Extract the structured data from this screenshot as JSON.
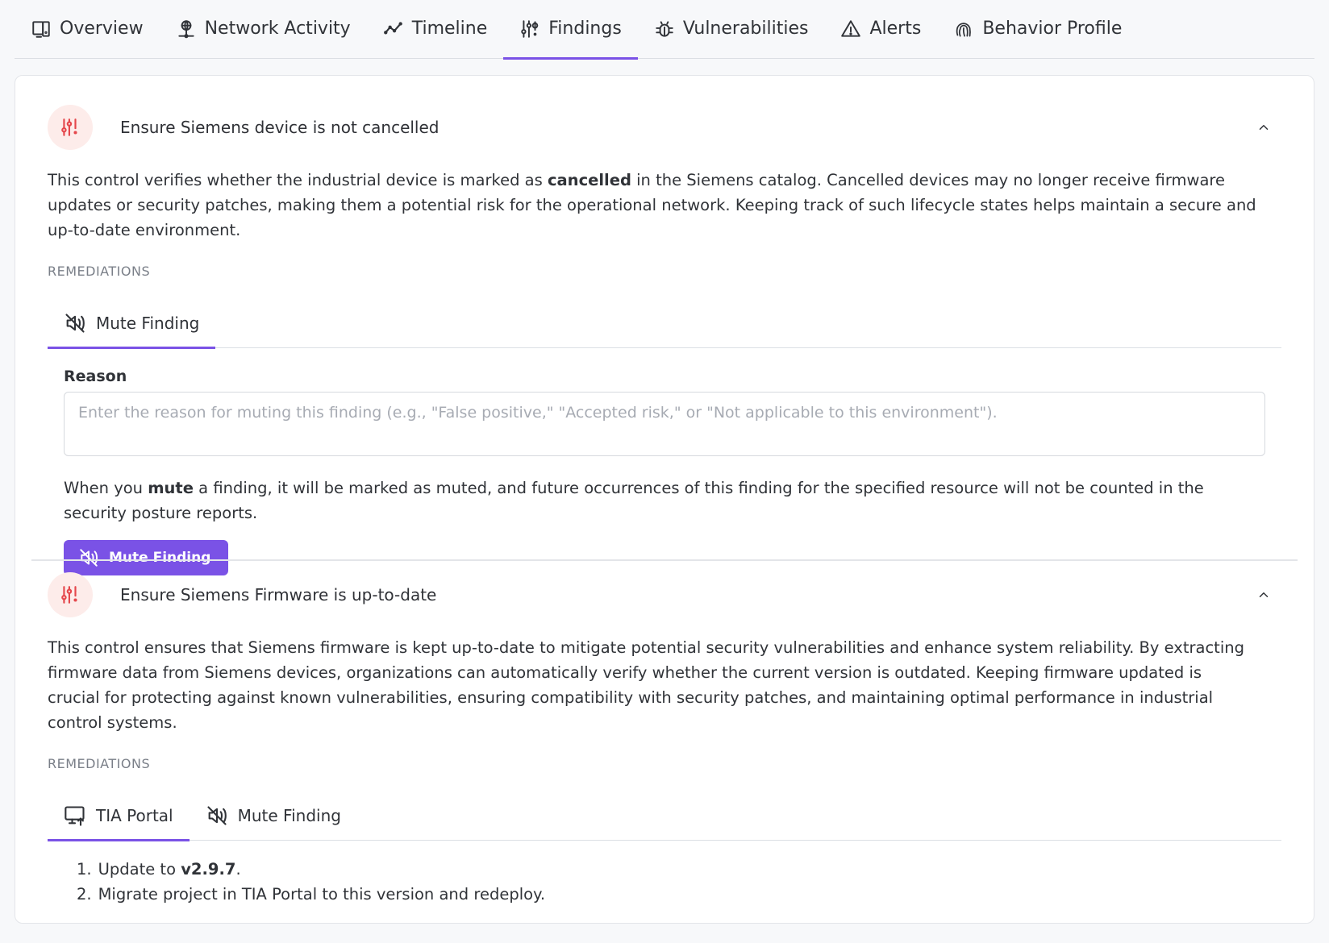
{
  "tabs": [
    {
      "label": "Overview",
      "icon": "device-icon"
    },
    {
      "label": "Network Activity",
      "icon": "network-icon"
    },
    {
      "label": "Timeline",
      "icon": "timeline-icon"
    },
    {
      "label": "Findings",
      "icon": "sliders-alert-icon",
      "active": true
    },
    {
      "label": "Vulnerabilities",
      "icon": "bug-icon"
    },
    {
      "label": "Alerts",
      "icon": "warning-icon"
    },
    {
      "label": "Behavior Profile",
      "icon": "fingerprint-icon"
    }
  ],
  "colors": {
    "accent": "#7a52e6",
    "danger": "#e5484d",
    "danger_bg": "#fdecea"
  },
  "findings": [
    {
      "title": "Ensure Siemens device is not cancelled",
      "desc_pre": "This control verifies whether the industrial device is marked as ",
      "desc_bold": "cancelled",
      "desc_post": " in the Siemens catalog. Cancelled devices may no longer receive firmware updates or security patches, making them a potential risk for the operational network. Keeping track of such lifecycle states helps maintain a secure and up-to-date environment.",
      "remediations_label": "REMEDIATIONS",
      "subtabs": [
        {
          "label": "Mute Finding",
          "icon": "mute-icon",
          "active": true
        }
      ],
      "reason_label": "Reason",
      "reason_placeholder": "Enter the reason for muting this finding (e.g., \"False positive,\" \"Accepted risk,\" or \"Not applicable to this environment\").",
      "reason_value": "",
      "note_pre": "When you ",
      "note_bold": "mute",
      "note_post": " a finding, it will be marked as muted, and future occurrences of this finding for the specified resource will not be counted in the security posture reports.",
      "button_label": "Mute Finding"
    },
    {
      "title": "Ensure Siemens Firmware is up-to-date",
      "desc": "This control ensures that Siemens firmware is kept up-to-date to mitigate potential security vulnerabilities and enhance system reliability. By extracting firmware data from Siemens devices, organizations can automatically verify whether the current version is outdated. Keeping firmware updated is crucial for protecting against known vulnerabilities, ensuring compatibility with security patches, and maintaining optimal performance in industrial control systems.",
      "remediations_label": "REMEDIATIONS",
      "subtabs": [
        {
          "label": "TIA Portal",
          "icon": "monitor-upload-icon",
          "active": true
        },
        {
          "label": "Mute Finding",
          "icon": "mute-icon",
          "active": false
        }
      ],
      "steps": [
        {
          "num": "1.",
          "pre": "Update to ",
          "bold": "v2.9.7",
          "post": "."
        },
        {
          "num": "2.",
          "pre": "Migrate project in TIA Portal to this version and redeploy.",
          "bold": "",
          "post": ""
        }
      ]
    }
  ]
}
